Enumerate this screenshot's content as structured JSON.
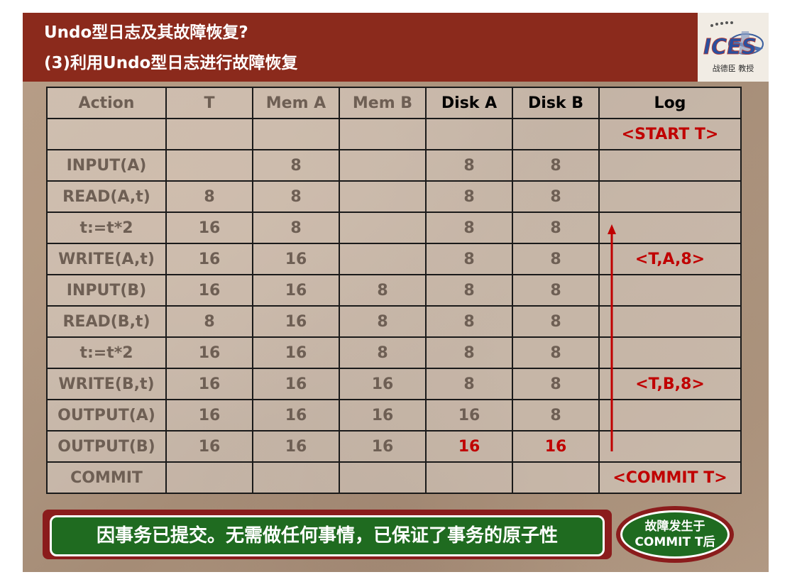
{
  "header": {
    "title_line1": "Undo型日志及其故障恢复?",
    "title_line2": "(3)利用Undo型日志进行故障恢复"
  },
  "logo": {
    "caption": "战德臣 教授"
  },
  "table": {
    "headers": [
      "Action",
      "T",
      "Mem A",
      "Mem B",
      "Disk A",
      "Disk B",
      "Log"
    ],
    "rows": [
      [
        "",
        "",
        "",
        "",
        "",
        "",
        "<START T>"
      ],
      [
        "INPUT(A)",
        "",
        "8",
        "",
        "8",
        "8",
        ""
      ],
      [
        "READ(A,t)",
        "8",
        "8",
        "",
        "8",
        "8",
        ""
      ],
      [
        "t:=t*2",
        "16",
        "8",
        "",
        "8",
        "8",
        ""
      ],
      [
        "WRITE(A,t)",
        "16",
        "16",
        "",
        "8",
        "8",
        "<T,A,8>"
      ],
      [
        "INPUT(B)",
        "16",
        "16",
        "8",
        "8",
        "8",
        ""
      ],
      [
        "READ(B,t)",
        "8",
        "16",
        "8",
        "8",
        "8",
        ""
      ],
      [
        "t:=t*2",
        "16",
        "16",
        "8",
        "8",
        "8",
        ""
      ],
      [
        "WRITE(B,t)",
        "16",
        "16",
        "16",
        "8",
        "8",
        "<T,B,8>"
      ],
      [
        "OUTPUT(A)",
        "16",
        "16",
        "16",
        "16",
        "8",
        ""
      ],
      [
        "OUTPUT(B)",
        "16",
        "16",
        "16",
        "16",
        "16",
        ""
      ],
      [
        "COMMIT",
        "",
        "",
        "",
        "",
        "",
        "<COMMIT T>"
      ]
    ]
  },
  "banner": {
    "text": "因事务已提交。无需做任何事情，已保证了事务的原子性"
  },
  "oval": {
    "line1": "故障发生于",
    "line2": "COMMIT T后"
  },
  "colors": {
    "header_bg": "#8b2a1c",
    "highlight_red": "#c00000",
    "banner_green": "#1f6b20"
  }
}
